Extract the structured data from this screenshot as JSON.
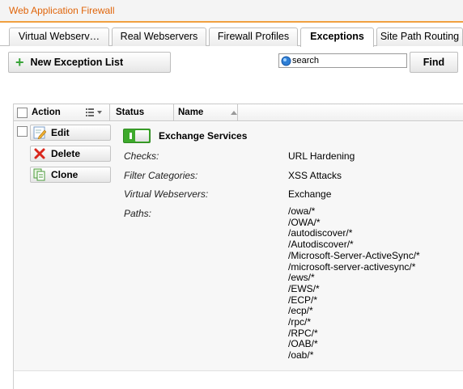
{
  "window": {
    "title": "Web Application Firewall"
  },
  "tabs": [
    {
      "label": "Virtual Webserv…",
      "active": false
    },
    {
      "label": "Real Webservers",
      "active": false
    },
    {
      "label": "Firewall Profiles",
      "active": false
    },
    {
      "label": "Exceptions",
      "active": true
    },
    {
      "label": "Site Path Routing",
      "active": false
    }
  ],
  "toolbar": {
    "new_label": "New Exception List",
    "new_icon": "plus-icon",
    "search_value": "search",
    "find_label": "Find"
  },
  "grid": {
    "columns": {
      "action": "Action",
      "status": "Status",
      "name": "Name"
    },
    "row": {
      "actions": {
        "edit": "Edit",
        "delete": "Delete",
        "clone": "Clone"
      },
      "enabled": true,
      "name": "Exchange Services",
      "details": [
        {
          "label": "Checks:",
          "value": "URL Hardening"
        },
        {
          "label": "Filter Categories:",
          "value": "XSS Attacks"
        },
        {
          "label": "Virtual Webservers:",
          "value": "Exchange"
        }
      ],
      "paths_label": "Paths:",
      "paths": [
        "/owa/*",
        "/OWA/*",
        "/autodiscover/*",
        "/Autodiscover/*",
        "/Microsoft-Server-ActiveSync/*",
        "/microsoft-server-activesync/*",
        "/ews/*",
        "/EWS/*",
        "/ECP/*",
        "/ecp/*",
        "/rpc/*",
        "/RPC/*",
        "/OAB/*",
        "/oab/*"
      ]
    }
  },
  "colors": {
    "accent": "#e0650a",
    "toggle_on": "#3eaa2c",
    "add_icon": "#3aa43a",
    "delete_icon": "#d9261c"
  }
}
